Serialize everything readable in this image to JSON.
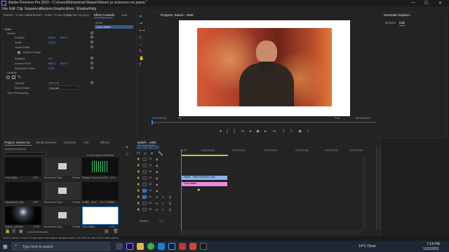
{
  "window": {
    "title": "Adobe Premiere Pro 2019 - C:\\Users\\Muhammad Waqar\\Videos\\ pr sc\\screen rec.prproj *",
    "minimize": "—",
    "maximize": "☐",
    "close": "✕"
  },
  "menu": [
    "File",
    "Edit",
    "Clip",
    "Sequence",
    "Markers",
    "Graphics",
    "View",
    "Window",
    "Help"
  ],
  "effect_controls": {
    "tabs": [
      "Master * Color Matte",
      "Bokeh - 4460 * Color Matte",
      "Lumetri Scopes",
      "Effect Controls",
      "Aud"
    ],
    "mini_time": "00:00",
    "mini_clip": "Color Matte",
    "section_video": "Video",
    "section_motion": "Motion",
    "rows": [
      {
        "label": "Position",
        "value": "960.0",
        "value2": "540.0"
      },
      {
        "label": "Scale",
        "value": "100.0",
        "value2": ""
      },
      {
        "label": "Scale Width",
        "value": "",
        "value2": ""
      },
      {
        "label": "Uniform Scale",
        "value": "",
        "value2": ""
      },
      {
        "label": "Rotation",
        "value": "0.0",
        "value2": ""
      },
      {
        "label": "Anchor Point",
        "value": "960.0",
        "value2": "540.0"
      },
      {
        "label": "Anti-flicker Filter",
        "value": "0.00",
        "value2": ""
      }
    ],
    "section_opacity": "Opacity",
    "opacity_label": "Opacity",
    "opacity_value": "100.0 %",
    "blend_label": "Blend Mode",
    "blend_value": "Normal",
    "time_remap": "Time Remapping"
  },
  "program": {
    "title": "Program: Bokeh - 4460",
    "tc_in": "00:00:00:00",
    "fit": "Fit",
    "full": "Full",
    "tc_out": "00:00:08:07"
  },
  "essential": {
    "title": "Essential Graphics",
    "tabs": [
      "Browse",
      "Edit"
    ]
  },
  "project": {
    "tabs": [
      "Project: screen rec",
      "Media Browser",
      "Libraries",
      "Info",
      "Effects"
    ],
    "search_placeholder": "screen rec.prproj",
    "count": "1 of 24 items selected",
    "items": [
      {
        "name": "Color Matte",
        "dur": "5:00"
      },
      {
        "name": "Recovered Clips",
        "dur": "5 items"
      },
      {
        "name": "Royalty Free Sound Eff...",
        "dur": "0:14"
      },
      {
        "name": "Adjustment Layer",
        "dur": "5:00"
      },
      {
        "name": "Recovered Clips",
        "dur": "3 items"
      },
      {
        "name": "shuffle - Ama... - 24 1 1920X",
        "dur": "0:14"
      },
      {
        "name": "Shaws - Untitled...",
        "dur": "17:56"
      },
      {
        "name": "Recovered Clips",
        "dur": "3 items"
      },
      {
        "name": "Color Matte",
        "dur": "5:00"
      }
    ]
  },
  "timeline": {
    "tab": "Bokeh - 4460",
    "timecode": "00:00:00:00",
    "ruler": [
      "00:00",
      "00:00:05:00",
      "00:00:10:00",
      "00:00:15:00",
      "00:00:20:00",
      "00:00:25:00",
      "00:00:30:00"
    ],
    "video_tracks": [
      "V6",
      "V5",
      "V4",
      "V3",
      "V2",
      "V1"
    ],
    "audio_tracks": [
      "A1",
      "A2",
      "A3"
    ],
    "master": "Master",
    "master_val": "0.0",
    "clips": [
      {
        "name": "Maker - 5Wm+6Wmaps.mp4",
        "color": "#8fb1e8"
      },
      {
        "name": "Color Matte",
        "color": "#e88be0"
      }
    ]
  },
  "status": {
    "text": "Click to select, or click in empty space and drag to marquee select. Use Shift, Alt, and Ctrl for other options."
  },
  "taskbar": {
    "search": "Type here to search",
    "weather": "14°C  Clear",
    "time": "7:14 PM",
    "date": "1/15/2023"
  }
}
